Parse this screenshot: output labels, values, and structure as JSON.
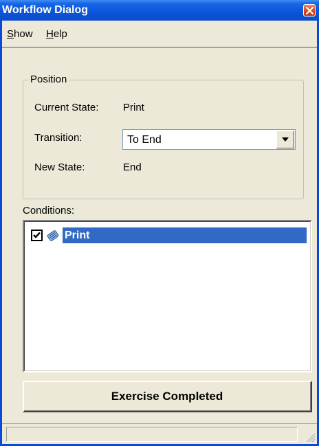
{
  "window": {
    "title": "Workflow Dialog"
  },
  "menu": {
    "show_prefix": "",
    "show_accel": "S",
    "show_rest": "how",
    "help_accel": "H",
    "help_rest": "elp"
  },
  "position": {
    "legend": "Position",
    "current_state_label": "Current State:",
    "current_state_value": "Print",
    "transition_label": "Transition:",
    "transition_value": "To End",
    "new_state_label": "New State:",
    "new_state_value": "End"
  },
  "conditions": {
    "label": "Conditions:",
    "items": [
      {
        "label": "Print",
        "checked": true,
        "selected": true,
        "icon": "workflow-condition-icon"
      }
    ]
  },
  "buttons": {
    "exercise_label": "Exercise Completed"
  },
  "colors": {
    "title_bar": "#0b55d8",
    "selection": "#316ac5",
    "dialog_bg": "#ece9d8",
    "close_button": "#d4451e"
  }
}
